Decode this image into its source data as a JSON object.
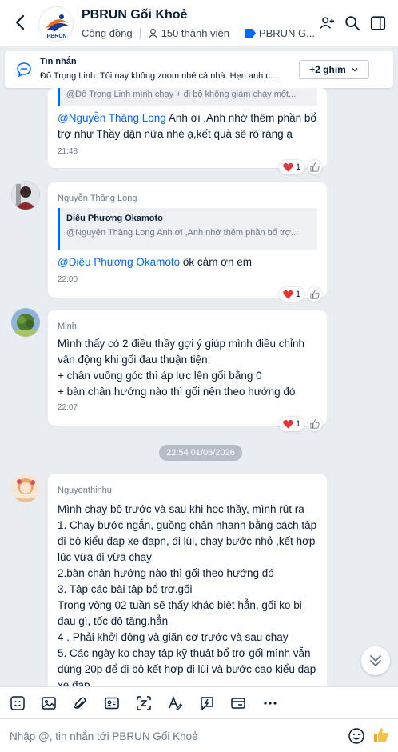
{
  "header": {
    "title": "PBRUN Gối Khoẻ",
    "type": "Cộng đồng",
    "members": "150 thành viên",
    "tag": "PBRUN G...",
    "avatar_text": "PBRUN"
  },
  "pinned": {
    "title": "Tin nhắn",
    "text": "Đỗ Trọng Linh: Tối nay không zoom nhé cả nhà. Hẹn anh c...",
    "button": "+2 ghim"
  },
  "messages": [
    {
      "quote_text": "@Đỗ Trọng Linh mình chạy + đi bộ không giám chạy một...",
      "mention": "@Nguyễn Thăng Long",
      "body_line1_rest": " Anh ơi ,Anh nhớ thêm phần bổ",
      "body_line2": "trợ như Thầy dặn nữa nhé ạ,kết quả sẽ rõ ràng ạ",
      "time": "21:48",
      "reaction_count": "1"
    },
    {
      "sender": "Nguyễn Thăng Long",
      "quote_name": "Diệu Phương Okamoto",
      "quote_text": "@Nguyễn Thăng Long Anh ơi ,Anh nhớ thêm phần bổ trợ...",
      "mention": "@Diệu Phương Okamoto",
      "body_rest": " ôk cảm ơn em",
      "time": "22:00",
      "reaction_count": "1"
    },
    {
      "sender": "Minh",
      "lines": [
        "Mình thấy có 2 điều thầy gợi ý giúp mình điều chỉnh",
        "vận động khi gối đau thuận tiện:",
        "+ chân vuông góc thì áp lực lên gối bằng 0",
        "+ bàn chân hướng nào thì gối nên theo hướng đó"
      ],
      "time": "22:07",
      "reaction_count": "1"
    },
    {
      "sender": "Nguyenthinhu",
      "lines": [
        "Mình chạy bộ trước và sau khi học  thầy, mình rút ra",
        "1. Chạy bước ngắn, guồng chân nhanh bằng cách tập",
        "đi bộ kiểu đạp xe đapn, đi lùi, chạy bước nhỏ ,kết hợp",
        "lúc vừa đi vừa chạy",
        "2.bàn chân hướng nào thì gối theo hướng đó",
        "3. Tập các bài tập bổ trợ.gối",
        "Trong vòng 02 tuần sẽ thấy khác biệt hẳn, gối ko bị",
        "đau gì, tốc độ tăng.hẳn",
        "4 . Phải khởi động và giãn cơ trước và sau chạy",
        "5. Các ngày ko chạy tập kỹ thuật bổ trợ gối mình vẫn",
        "dùng 20p để đi bộ kết hợp đi lùi và bước cao kiểu đạp",
        "xe đạp"
      ]
    }
  ],
  "date_separator": "22:54 01/06/2026",
  "composer": {
    "placeholder": "Nhập @, tin nhắn tới PBRUN Gối Khoẻ"
  },
  "colors": {
    "accent": "#0068ff",
    "heart": "#e8323c",
    "bg": "#e9edf2"
  },
  "icons": [
    "back-icon",
    "add-member-icon",
    "search-icon",
    "layout-icon",
    "chat-bubble-icon",
    "chevron-down-icon",
    "heart-icon",
    "thumb-up-icon",
    "sticker-icon",
    "image-icon",
    "attach-icon",
    "contact-card-icon",
    "screenshot-icon",
    "format-text-icon",
    "quick-message-icon",
    "poll-card-icon",
    "more-icon",
    "emoji-icon",
    "like-icon",
    "scroll-down-icon"
  ]
}
